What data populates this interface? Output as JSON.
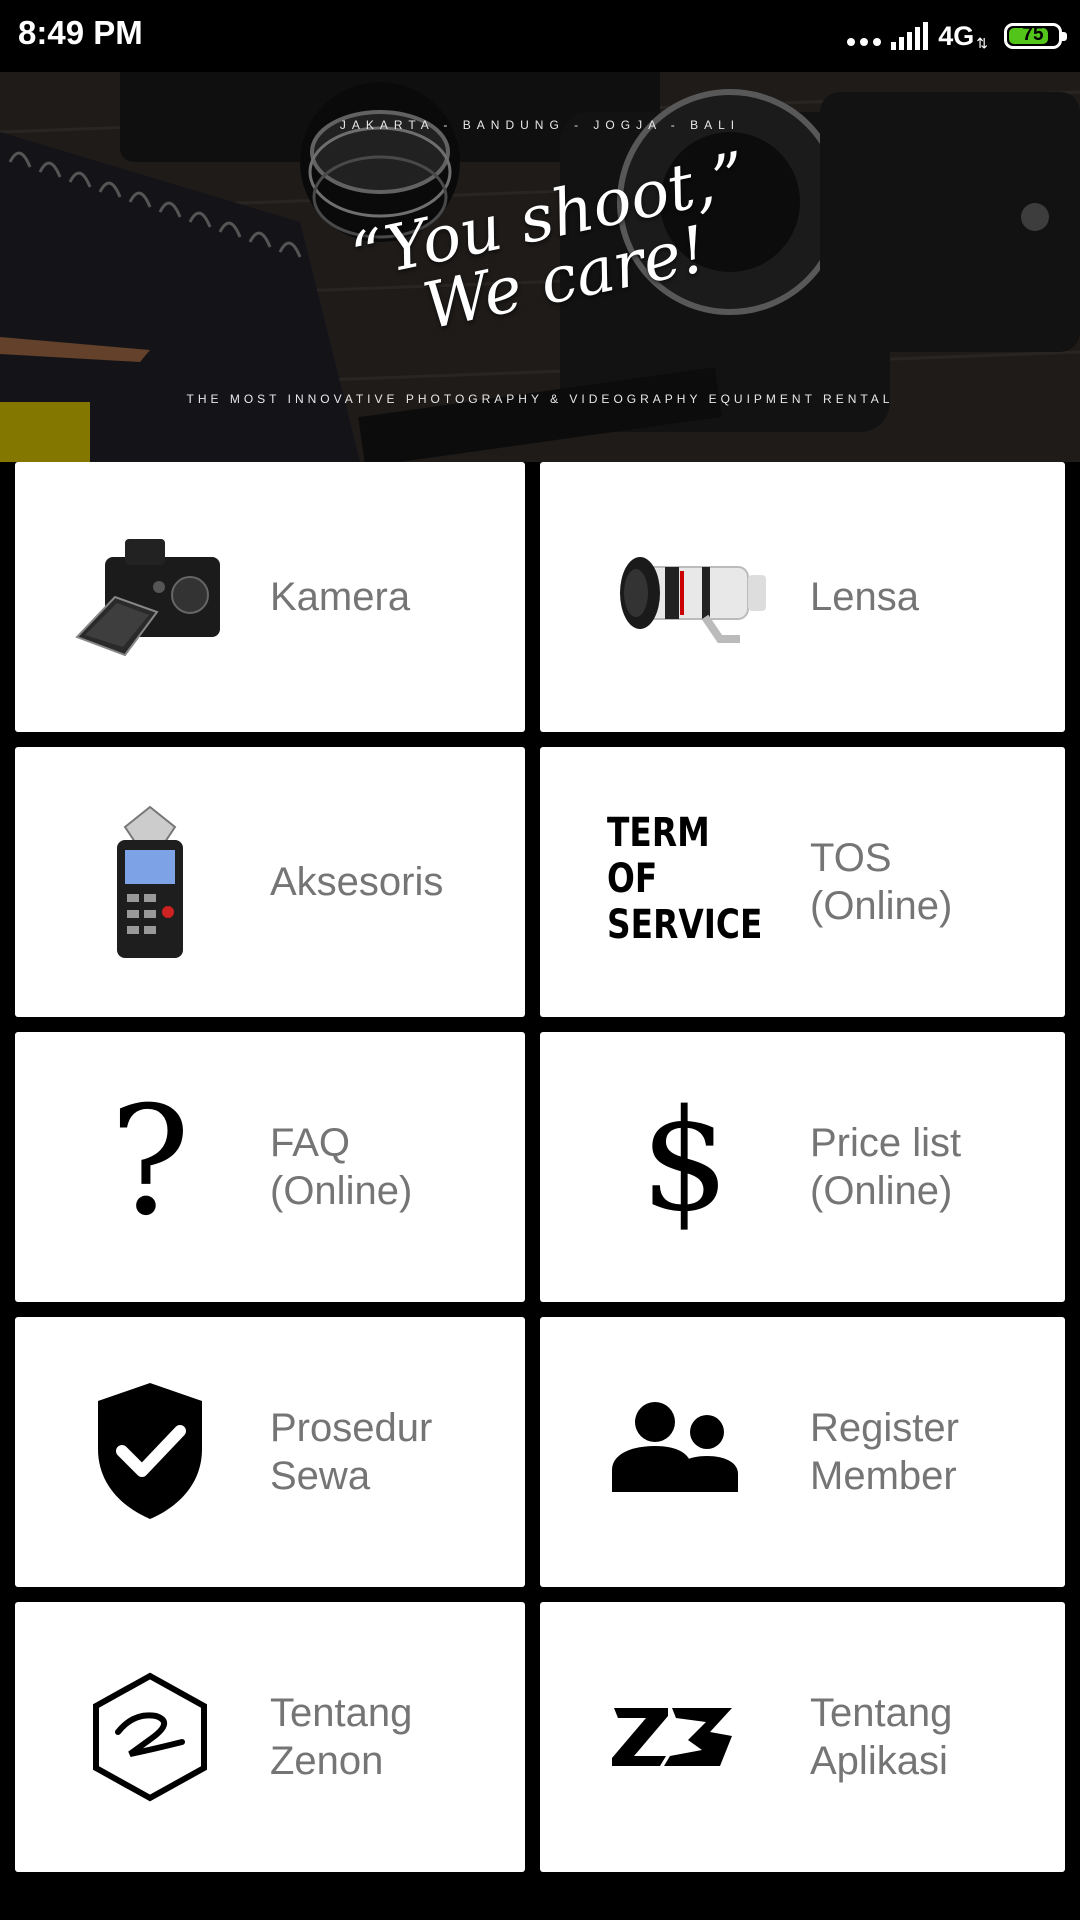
{
  "status_bar": {
    "time": "8:49 PM",
    "network": "4G",
    "battery": "75"
  },
  "banner": {
    "cities": "JAKARTA - BANDUNG - JOGJA - BALI",
    "quote_line1": "“You shoot,”",
    "quote_line2": "We care!",
    "tagline": "THE MOST INNOVATIVE PHOTOGRAPHY & VIDEOGRAPHY EQUIPMENT RENTAL"
  },
  "menu": {
    "kamera": "Kamera",
    "lensa": "Lensa",
    "aksesoris": "Aksesoris",
    "tos": "TOS\n(Online)",
    "tos_icon_text": "TERM OF\nSERVICE",
    "faq": "FAQ\n(Online)",
    "pricelist": "Price list\n(Online)",
    "prosedur": "Prosedur\nSewa",
    "register": "Register\nMember",
    "zenon": "Tentang\nZenon",
    "aplikasi": "Tentang\nAplikasi"
  },
  "icons": {
    "faq": "?",
    "pricelist": "$"
  },
  "colors": {
    "card_bg": "#ffffff",
    "label": "#757575",
    "background": "#000000",
    "battery": "#52c41a"
  }
}
